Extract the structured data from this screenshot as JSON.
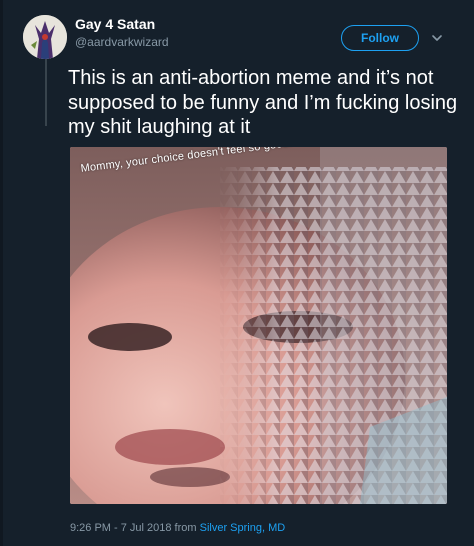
{
  "author": {
    "display_name": "Gay 4 Satan",
    "handle": "@aardvarkwizard"
  },
  "actions": {
    "follow_label": "Follow",
    "more_icon": "chevron-down-icon"
  },
  "tweet": {
    "text": "This is an anti-abortion meme and it’s not supposed to be funny and I’m fucking losing my shit laughing at it"
  },
  "media": {
    "caption": "Mommy, your choice doesn't feel so good."
  },
  "meta": {
    "time_date": "9:26 PM - 7 Jul 2018 from",
    "location": "Silver Spring, MD"
  },
  "colors": {
    "background": "#15202b",
    "accent": "#1da1f2",
    "secondary_text": "#8899a6"
  }
}
